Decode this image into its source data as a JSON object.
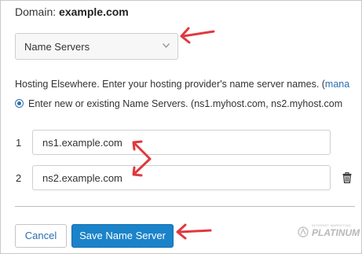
{
  "domain": {
    "label": "Domain:",
    "value": "example.com"
  },
  "selector": {
    "selected": "Name Servers",
    "icon": "chevron-down-icon"
  },
  "info": {
    "text": "Hosting Elsewhere. Enter your hosting provider's name server names. (",
    "link": "mana"
  },
  "radio": {
    "label": "Enter new or existing Name Servers. (ns1.myhost.com, ns2.myhost.com"
  },
  "nameservers": [
    {
      "num": "1",
      "value": "ns1.example.com"
    },
    {
      "num": "2",
      "value": "ns2.example.com"
    }
  ],
  "actions": {
    "cancel": "Cancel",
    "save": "Save Name Server"
  },
  "watermark": {
    "small": "INTERNET MARKETING",
    "big": "PLATINUM"
  },
  "colors": {
    "accent": "#1b83c9",
    "link": "#2a6fb0",
    "annotation": "#e0393e"
  }
}
